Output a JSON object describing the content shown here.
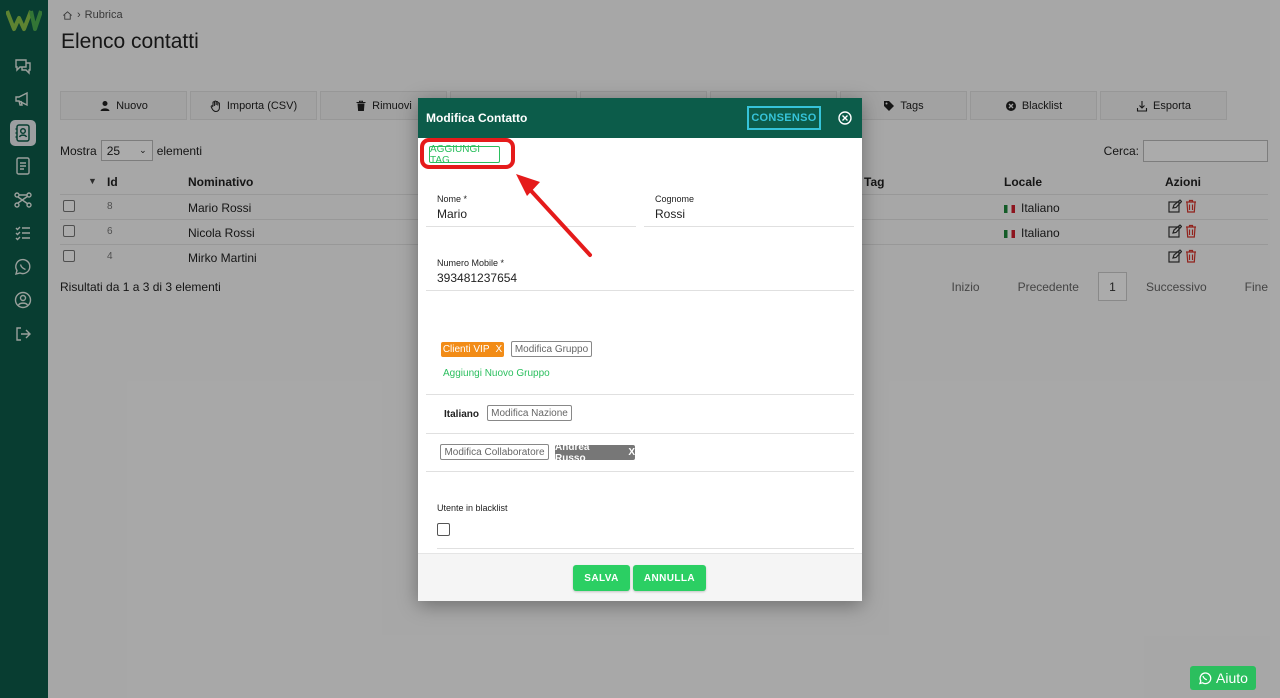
{
  "breadcrumb": {
    "current": "Rubrica"
  },
  "page": {
    "title": "Elenco contatti"
  },
  "toolbar": {
    "buttons": [
      {
        "label": "Nuovo",
        "icon": "user-icon"
      },
      {
        "label": "Importa (CSV)",
        "icon": "hand-icon"
      },
      {
        "label": "Rimuovi",
        "icon": "trash-icon"
      },
      {
        "label": "Tags",
        "icon": "tag-icon"
      },
      {
        "label": "Blacklist",
        "icon": "ban-icon"
      },
      {
        "label": "Esporta",
        "icon": "export-icon"
      }
    ]
  },
  "list": {
    "show_label": "Mostra",
    "show_value": "25",
    "show_suffix": "elementi",
    "search_label": "Cerca:"
  },
  "table": {
    "headers": {
      "id": "Id",
      "name": "Nominativo",
      "tag": "Tag",
      "locale": "Locale",
      "actions": "Azioni"
    },
    "rows": [
      {
        "id": "8",
        "name": "Mario Rossi",
        "locale": "Italiano"
      },
      {
        "id": "6",
        "name": "Nicola Rossi",
        "locale": "Italiano"
      },
      {
        "id": "4",
        "name": "Mirko Martini",
        "locale": ""
      }
    ]
  },
  "results_text": "Risultati da 1 a 3 di 3 elementi",
  "pagination": {
    "first": "Inizio",
    "prev": "Precedente",
    "current": "1",
    "next": "Successivo",
    "last": "Fine"
  },
  "modal": {
    "title": "Modifica Contatto",
    "consenso_label": "CONSENSO",
    "add_tag_label": "AGGIUNGI TAG",
    "nome_label": "Nome *",
    "nome_value": "Mario",
    "cognome_label": "Cognome",
    "cognome_value": "Rossi",
    "mobile_label": "Numero Mobile *",
    "mobile_value": "393481237654",
    "group_badge": "Clienti VIP",
    "group_badge_x": "X",
    "edit_group_label": "Modifica Gruppo",
    "add_group_label": "Aggiungi Nuovo Gruppo",
    "nation_value": "Italiano",
    "edit_nation_label": "Modifica Nazione",
    "edit_collab_label": "Modifica Collaboratore",
    "collab_badge": "Andrea Russo",
    "collab_badge_x": "X",
    "blacklist_label": "Utente in blacklist",
    "save_label": "SALVA",
    "cancel_label": "ANNULLA"
  },
  "help": {
    "label": "Aiuto"
  },
  "colors": {
    "brand": "#0c5c4a",
    "accent_green": "#2bcf63",
    "consenso": "#36c3d9",
    "highlight": "#e51b1b",
    "badge_orange": "#f28c17"
  }
}
